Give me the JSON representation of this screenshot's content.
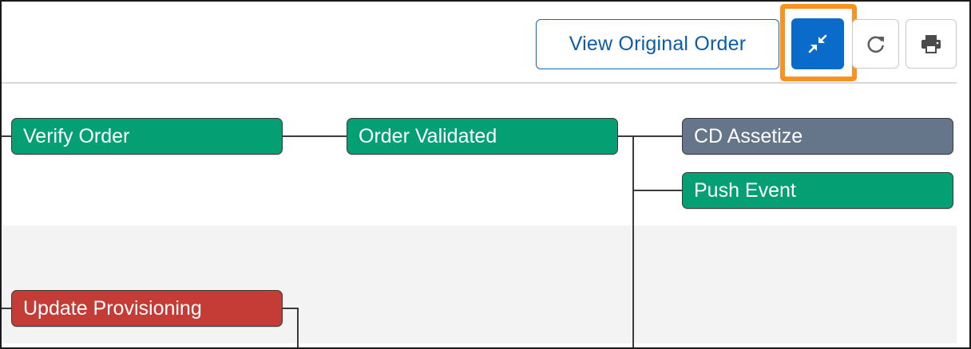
{
  "toolbar": {
    "view_original_order_label": "View Original Order",
    "collapse_icon": "collapse-arrows-icon",
    "refresh_icon": "refresh-icon",
    "print_icon": "printer-icon"
  },
  "flow": {
    "nodes": [
      {
        "id": "verify-order",
        "label": "Verify Order",
        "status": "complete"
      },
      {
        "id": "order-validated",
        "label": "Order Validated",
        "status": "complete"
      },
      {
        "id": "cd-assetize",
        "label": "CD Assetize",
        "status": "pending"
      },
      {
        "id": "push-event",
        "label": "Push Event",
        "status": "complete"
      },
      {
        "id": "update-provisioning",
        "label": "Update Provisioning",
        "status": "error"
      }
    ]
  },
  "colors": {
    "complete": "#04a073",
    "pending": "#65758a",
    "error": "#c53b36",
    "brand": "#0b6bcb",
    "highlight": "#f7931e"
  }
}
